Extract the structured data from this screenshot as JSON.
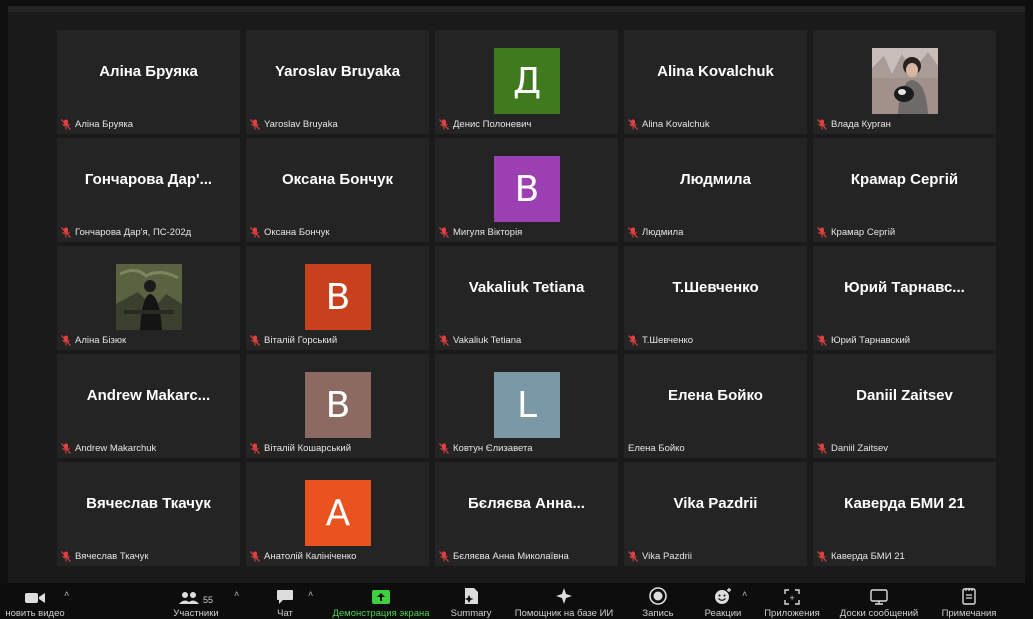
{
  "tiles": [
    {
      "display": "Аліна Бруяка",
      "label": "Аліна Бруяка",
      "muted": true
    },
    {
      "display": "Yaroslav Bruyaka",
      "label": "Yaroslav Bruyaka",
      "muted": true
    },
    {
      "avatar_letter": "Д",
      "avatar_color": "#3f7a1f",
      "label": "Денис Полоневич",
      "muted": true
    },
    {
      "display": "Alina Kovalchuk",
      "label": "Alina Kovalchuk",
      "muted": true
    },
    {
      "photo": "woman-with-dog",
      "label": "Влада Курган",
      "muted": true
    },
    {
      "display": "Гончарова Дар'...",
      "label": "Гончарова Дар'я, ПС-202д",
      "muted": true
    },
    {
      "display": "Оксана Бончук",
      "label": "Оксана Бончук",
      "muted": true
    },
    {
      "avatar_letter": "В",
      "avatar_color": "#9c3fb3",
      "label": "Мигуля Вікторія",
      "muted": true
    },
    {
      "display": "Людмила",
      "label": "Людмила",
      "muted": true
    },
    {
      "display": "Крамар Сергій",
      "label": "Крамар Сергій",
      "muted": true
    },
    {
      "photo": "woman-outdoors",
      "label": "Аліна Бізюк",
      "muted": true
    },
    {
      "avatar_letter": "В",
      "avatar_color": "#c8401c",
      "label": "Віталій Горський",
      "muted": true
    },
    {
      "display": "Vakaliuk Tetiana",
      "label": "Vakaliuk Tetiana",
      "muted": true
    },
    {
      "display": "Т.Шевченко",
      "label": "Т.Шевченко",
      "muted": true
    },
    {
      "display": "Юрий  Тарнавс...",
      "label": "Юрий Тарнавский",
      "muted": true
    },
    {
      "display": "Andrew  Makarc...",
      "label": "Andrew Makarchuk",
      "muted": true
    },
    {
      "avatar_letter": "В",
      "avatar_color": "#8c6a62",
      "label": "Віталій Кошарський",
      "muted": true
    },
    {
      "avatar_letter": "L",
      "avatar_color": "#7a98a6",
      "label": "Ковтун Єлизавета",
      "muted": true
    },
    {
      "display": "Елена Бойко",
      "label": "Елена Бойко",
      "muted": false
    },
    {
      "display": "Daniil Zaitsev",
      "label": "Daniil Zaitsev",
      "muted": true
    },
    {
      "display": "Вячеслав Ткачук",
      "label": "Вячеслав Ткачук",
      "muted": true
    },
    {
      "avatar_letter": "А",
      "avatar_color": "#e8531f",
      "label": "Анатолій Калініченко",
      "muted": true
    },
    {
      "display": "Бєляєва  Анна...",
      "label": "Бєляєва Анна Миколаївна",
      "muted": true
    },
    {
      "display": "Vika Pazdrii",
      "label": "Vika Pazdrii",
      "muted": true
    },
    {
      "display": "Каверда БМИ 21",
      "label": "Каверда БМИ 21",
      "muted": true
    }
  ],
  "toolbar": {
    "video_label": "новить видео",
    "participants_label": "Участники",
    "participants_count": "55",
    "chat_label": "Чат",
    "share_label": "Демонстрация экрана",
    "summary_label": "Summary",
    "assistant_label": "Помощник на базе ИИ",
    "record_label": "Запись",
    "reactions_label": "Реакции",
    "apps_label": "Приложения",
    "boards_label": "Доски сообщений",
    "notes_label": "Примечания"
  },
  "colors": {
    "share_green": "#4ad24a",
    "muted_red": "#e04040",
    "tile_bg": "#242424"
  }
}
